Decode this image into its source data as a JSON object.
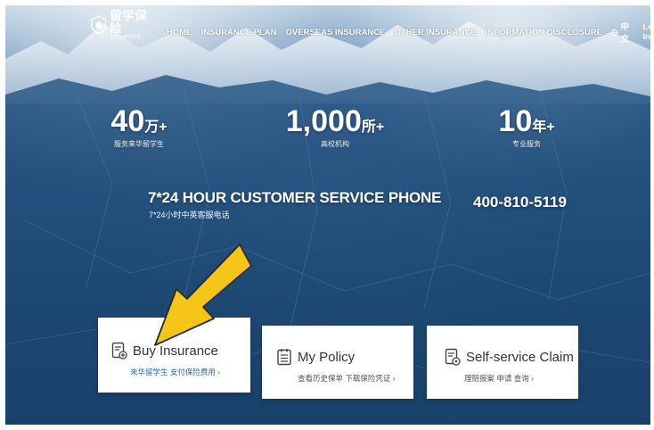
{
  "header": {
    "logo_text": "留学保险",
    "logo_subtext": "在华外籍留学生",
    "nav": [
      "HOME",
      "INSURANCE PLAN",
      "OVERSEAS INSURANCE",
      "OTHER INSURANCE",
      "INFORMATION DISCLOSURE"
    ],
    "language": "中文",
    "login": "Log In"
  },
  "stats": [
    {
      "value": "40",
      "unit": "万+",
      "label": "服务来华留学生"
    },
    {
      "value": "1,000",
      "unit": "所+",
      "label": "高校机构"
    },
    {
      "value": "10",
      "unit": "年+",
      "label": "专业服务"
    }
  ],
  "service": {
    "title": "7*24 HOUR CUSTOMER SERVICE PHONE",
    "subtitle": "7*24小时中英客服电话",
    "phone": "400-810-5119"
  },
  "cards": [
    {
      "icon": "insurance-plus-icon",
      "title": "Buy Insurance",
      "desc": "来华留学生 支付保险费用 ›"
    },
    {
      "icon": "policy-list-icon",
      "title": "My Policy",
      "desc": "查看历史保单 下载保险凭证 ›"
    },
    {
      "icon": "claim-document-icon",
      "title": "Self-service Claim",
      "desc": "理赔报案 申请 查询 ›"
    }
  ],
  "colors": {
    "accent_link": "#2b6cb0",
    "arrow": "#f5c518"
  }
}
